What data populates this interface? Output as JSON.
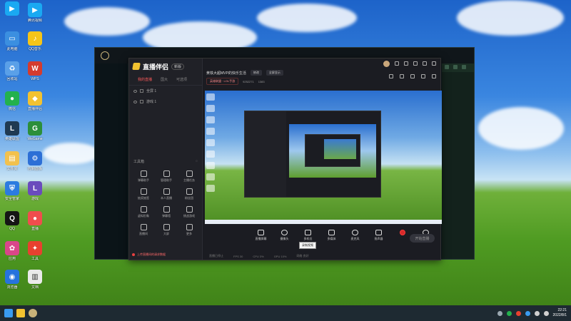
{
  "desktop": {
    "icons": [
      {
        "label": "腾讯视频",
        "color": "#1aa9f2"
      },
      {
        "label": "此电脑",
        "color": "#3b8fe0"
      },
      {
        "label": "QQ音乐",
        "color": "#f5c518"
      },
      {
        "label": "回收站",
        "color": "#5aa0e8"
      },
      {
        "label": "WPS",
        "color": "#d43b2e"
      },
      {
        "label": "微信",
        "color": "#23b14d"
      },
      {
        "label": "直播伴侣",
        "color": "#f2c230"
      },
      {
        "label": "英雄联盟",
        "color": "#1f3a52"
      },
      {
        "label": "WeGame",
        "color": "#2c8f3a"
      },
      {
        "label": "文件夹",
        "color": "#f2c14e"
      },
      {
        "label": "控制面板",
        "color": "#2d6fd6"
      },
      {
        "label": "安全管家",
        "color": "#2b7be0"
      },
      {
        "label": "游戏",
        "color": "#6a4bbd"
      },
      {
        "label": "QQ",
        "color": "#151515"
      },
      {
        "label": "直播",
        "color": "#f04d4d"
      },
      {
        "label": "应用",
        "color": "#d9468a"
      },
      {
        "label": "工具",
        "color": "#e8402f"
      },
      {
        "label": "浏览器",
        "color": "#2673dd"
      },
      {
        "label": "文档",
        "color": "#eaeaea"
      }
    ]
  },
  "app": {
    "brand": "直播伴侣",
    "version": "新版",
    "tabs": [
      "我的直播",
      "国大",
      "可选项"
    ],
    "scenes": [
      "全屏 1",
      "游戏 1"
    ],
    "tools_title": "工具箱",
    "tools": [
      "弹幕助手",
      "管理助手",
      "主播任务",
      "抽奖抽签",
      "本人直播",
      "粉丝团",
      "虚拟形象",
      "弹幕墙",
      "挑战游戏",
      "直播间",
      "大屏",
      "更多"
    ],
    "footer_warning": "上传直播间的请求数据",
    "room_title": "黄铁大超MVP的快乐生活",
    "room_pill": "修改",
    "room_pill2": "全屏显示",
    "category": "英雄联盟 · LOL手游",
    "room_id": "9252271",
    "viewers": "1383",
    "controls": [
      "直播屏幕",
      "摄像头",
      "多机位",
      "多媒体",
      "麦克风",
      "扬声器",
      "录制"
    ],
    "start_button": "开始直播",
    "tooltip": "录制视频",
    "status": [
      "直播已停止",
      "FPS 30",
      "CPU 3%",
      "GPU 10%",
      "网络 良好"
    ]
  },
  "taskbar": {
    "time": "22:21",
    "date": "2022/8/1"
  }
}
